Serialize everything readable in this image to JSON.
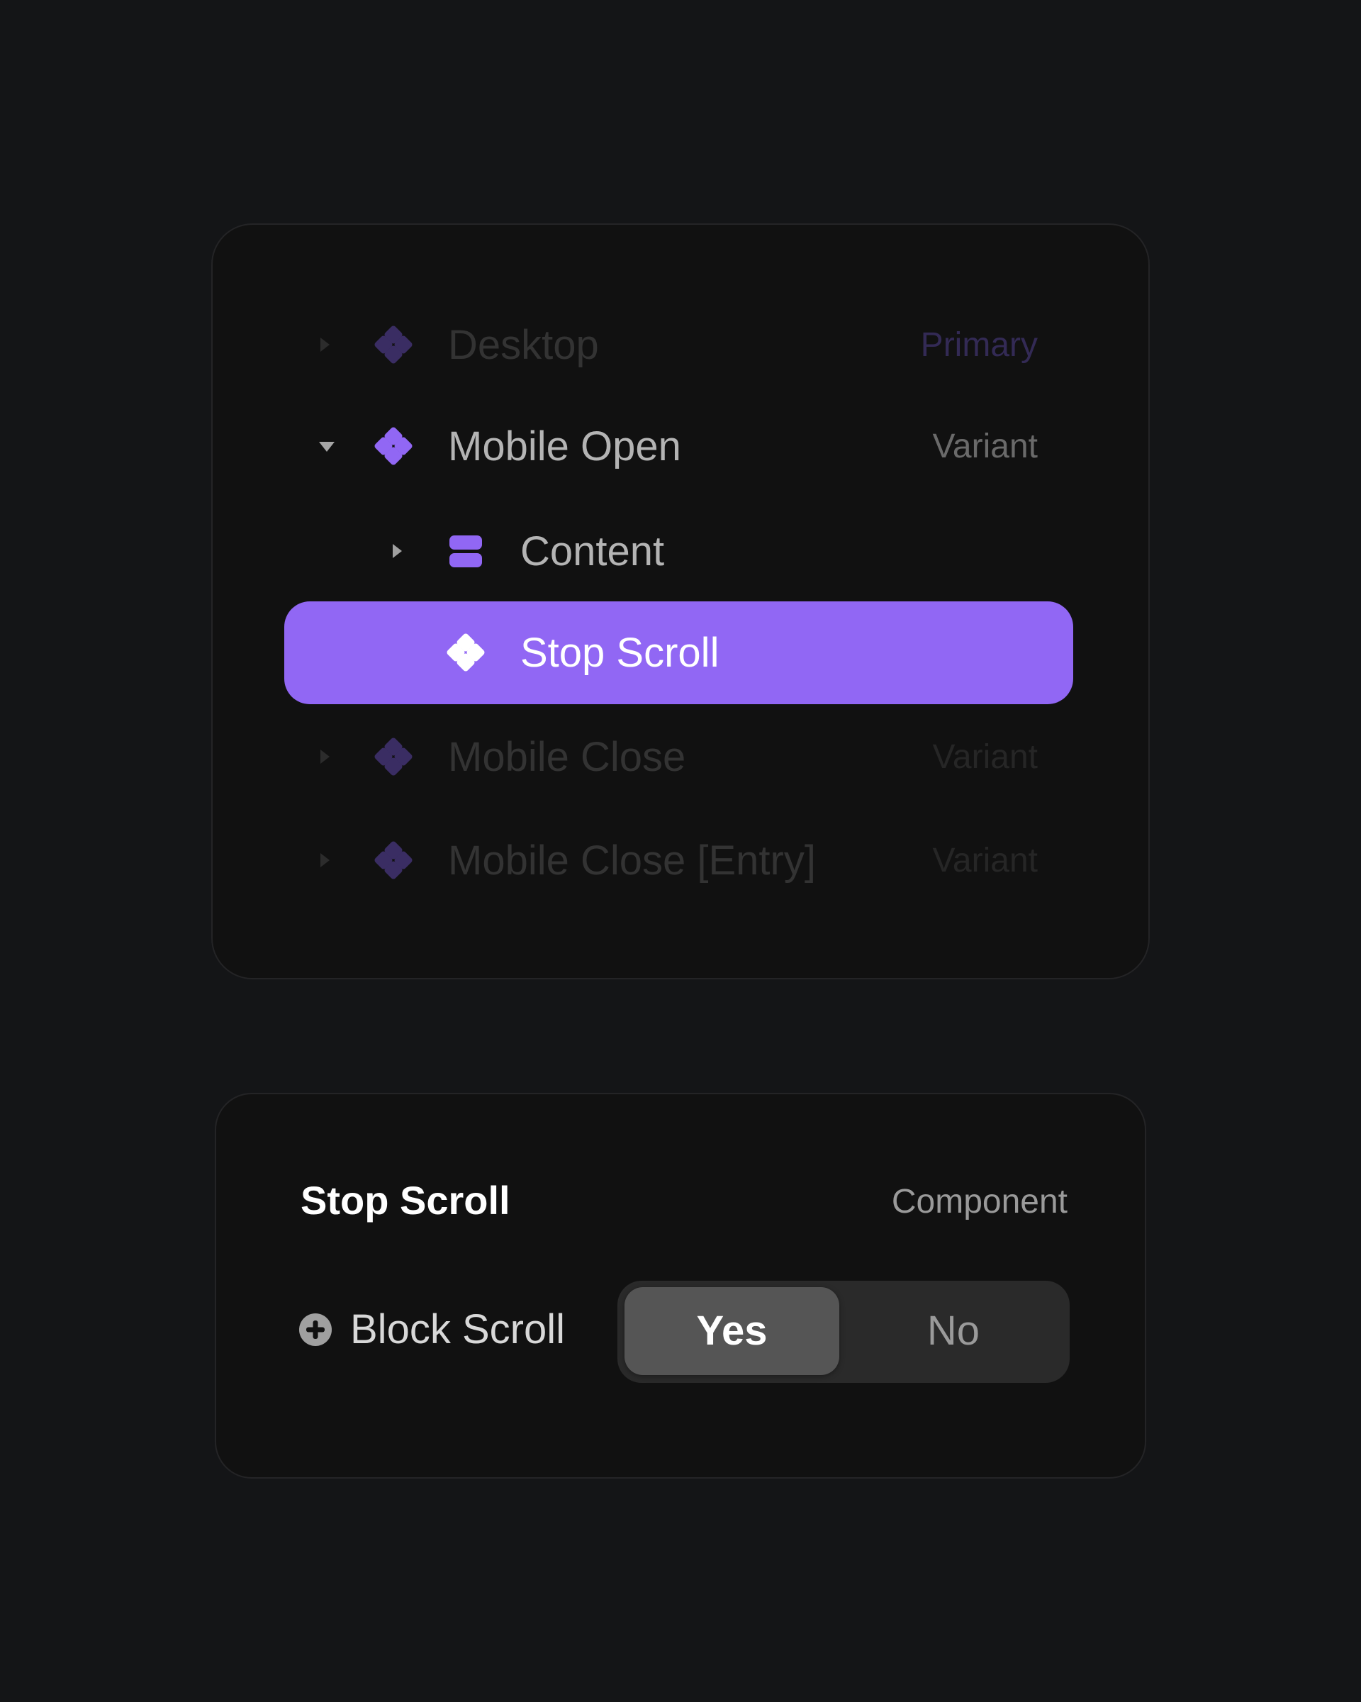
{
  "colors": {
    "accent": "#9167F4",
    "accent_dim": "#3a2d63",
    "page_bg": "#141517",
    "card_bg": "#111111"
  },
  "layers": {
    "rows": [
      {
        "label": "Desktop",
        "tag": "Primary",
        "expanded": false,
        "icon": "component-icon",
        "state": "dimmed"
      },
      {
        "label": "Mobile Open",
        "tag": "Variant",
        "expanded": true,
        "icon": "component-icon",
        "state": "normal"
      },
      {
        "label": "Content",
        "tag": "",
        "expanded": false,
        "icon": "frame-stack-icon",
        "state": "normal"
      },
      {
        "label": "Stop Scroll",
        "tag": "",
        "expanded": null,
        "icon": "component-icon",
        "state": "selected"
      },
      {
        "label": "Mobile Close",
        "tag": "Variant",
        "expanded": false,
        "icon": "component-icon",
        "state": "dimmed"
      },
      {
        "label": "Mobile Close [Entry]",
        "tag": "Variant",
        "expanded": false,
        "icon": "component-icon",
        "state": "dimmed"
      }
    ]
  },
  "properties": {
    "title": "Stop Scroll",
    "type": "Component",
    "property": {
      "label": "Block Scroll",
      "icon": "plus-circle-icon",
      "options": [
        "Yes",
        "No"
      ],
      "selected": "Yes"
    }
  }
}
